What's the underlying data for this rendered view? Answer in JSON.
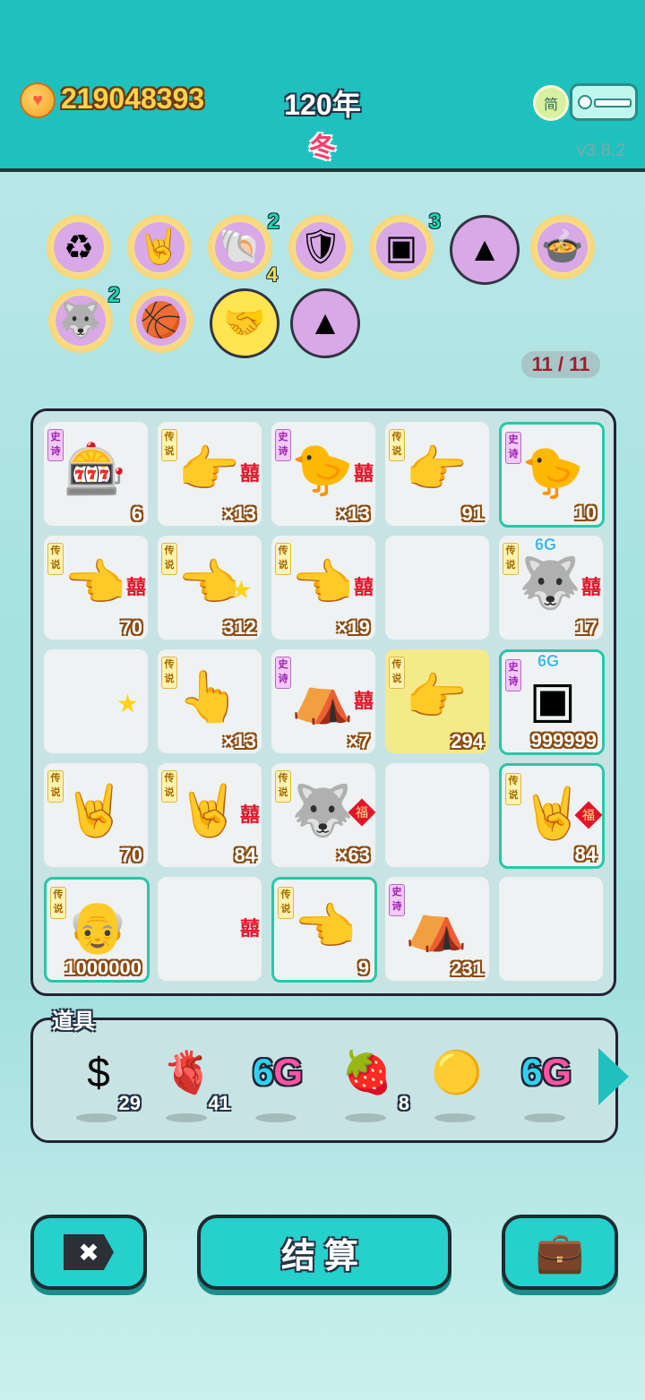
{
  "header": {
    "coins": "219048393",
    "year": "120年",
    "season": "冬",
    "lang": "简",
    "version": "v3.8.2"
  },
  "badges": [
    {
      "icon": "recycle-icon",
      "glyph": "♻"
    },
    {
      "icon": "rock-hand-icon",
      "glyph": "🤘"
    },
    {
      "icon": "shell-icon",
      "glyph": "🐚",
      "count": "2",
      "count2": "4"
    },
    {
      "icon": "shield-wrench-icon",
      "glyph": "🛡"
    },
    {
      "icon": "chip-icon",
      "glyph": "▣",
      "count": "3"
    },
    {
      "icon": "skirt-icon",
      "glyph": "▲"
    },
    {
      "icon": "bowls-icon",
      "glyph": "🍲"
    },
    {
      "icon": "husky-icon",
      "glyph": "🐺",
      "count": "2"
    },
    {
      "icon": "basketballs-icon",
      "glyph": "🏀"
    },
    {
      "icon": "handshake-icon",
      "glyph": "🤝"
    },
    {
      "icon": "skirt-icon-2",
      "glyph": "▲"
    }
  ],
  "pager": "11 / 11",
  "board": [
    {
      "tag": "史诗",
      "tagType": "epic",
      "icon": "gacha-machine-icon",
      "glyph": "🎰",
      "value": "6"
    },
    {
      "tag": "传说",
      "tagType": "leg",
      "icon": "pointing-hand-icon",
      "glyph": "👉",
      "mark": "囍",
      "value": "×13"
    },
    {
      "tag": "史诗",
      "tagType": "epic",
      "icon": "grey-hair-chick-icon",
      "glyph": "🐤",
      "mark": "囍",
      "value": "×13"
    },
    {
      "tag": "传说",
      "tagType": "leg",
      "icon": "pointing-hand-icon",
      "glyph": "👉",
      "value": "91"
    },
    {
      "tag": "史诗",
      "tagType": "epic",
      "icon": "grey-hair-chick-icon",
      "glyph": "🐤",
      "value": "10",
      "sel": true
    },
    {
      "tag": "传说",
      "tagType": "leg",
      "icon": "pointing-hand-icon",
      "glyph": "👈",
      "mark": "囍",
      "value": "70"
    },
    {
      "tag": "传说",
      "tagType": "leg",
      "icon": "pointing-hand-icon",
      "glyph": "👈",
      "star": true,
      "value": "312"
    },
    {
      "tag": "传说",
      "tagType": "leg",
      "icon": "pointing-hand-icon",
      "glyph": "👈",
      "mark": "囍",
      "value": "×19"
    },
    {},
    {
      "tag": "传说",
      "tagType": "leg",
      "icon": "husky-king-icon",
      "glyph": "🐺",
      "mark": "囍",
      "top": "6G",
      "value": "17"
    },
    {
      "icon": "",
      "star": true
    },
    {
      "tag": "传说",
      "tagType": "leg",
      "icon": "pointing-hand-icon",
      "glyph": "👆",
      "value": "×13"
    },
    {
      "tag": "史诗",
      "tagType": "epic",
      "icon": "bunny-tent-icon",
      "glyph": "⛺",
      "mark": "囍",
      "value": "×7"
    },
    {
      "tag": "传说",
      "tagType": "leg",
      "icon": "pointing-hand-icon",
      "glyph": "👉",
      "value": "294",
      "hl": true
    },
    {
      "tag": "史诗",
      "tagType": "epic",
      "icon": "chip-icon",
      "glyph": "▣",
      "top": "6G",
      "value": "999999",
      "sel": true
    },
    {
      "tag": "传说",
      "tagType": "leg",
      "icon": "rock-hand-icon",
      "glyph": "🤘",
      "value": "70"
    },
    {
      "tag": "传说",
      "tagType": "leg",
      "icon": "rock-hand-icon",
      "glyph": "🤘",
      "mark": "囍",
      "value": "84"
    },
    {
      "tag": "传说",
      "tagType": "leg",
      "icon": "husky-king-icon",
      "glyph": "🐺",
      "fu": "福",
      "value": "×63"
    },
    {},
    {
      "tag": "传说",
      "tagType": "leg",
      "icon": "rock-hand-icon",
      "glyph": "🤘",
      "fu": "福",
      "value": "84",
      "sel": true
    },
    {
      "tag": "传说",
      "tagType": "leg",
      "icon": "bald-man-icon",
      "glyph": "👴",
      "value": "1000000",
      "sel": true
    },
    {
      "icon": "",
      "mark": "囍"
    },
    {
      "tag": "传说",
      "tagType": "leg",
      "icon": "pointing-hand-icon",
      "glyph": "👈",
      "value": "9",
      "sel": true
    },
    {
      "tag": "史诗",
      "tagType": "epic",
      "icon": "bunny-tent-icon",
      "glyph": "⛺",
      "value": "231"
    },
    {}
  ],
  "items": {
    "label": "道具",
    "list": [
      {
        "icon": "dollar-coin-icon",
        "glyph": "$",
        "qty": "29"
      },
      {
        "icon": "liver-icon",
        "glyph": "🫀",
        "qty": "41"
      },
      {
        "icon": "6g-icon",
        "text": "6G"
      },
      {
        "icon": "lychee-icon",
        "glyph": "🍓",
        "qty": "8"
      },
      {
        "icon": "gold-ball-icon",
        "glyph": "🟡"
      },
      {
        "icon": "6g-icon-2",
        "text": "6G"
      }
    ]
  },
  "buttons": {
    "close": "✖",
    "settle": "结算",
    "bag": "💼"
  }
}
